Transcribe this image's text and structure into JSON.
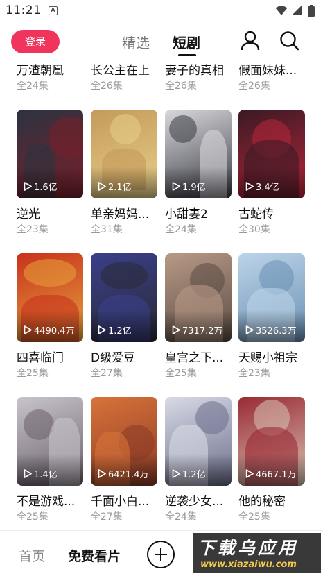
{
  "status_bar": {
    "time": "11:21",
    "notification_icon": "a-notification-icon"
  },
  "header": {
    "login_label": "登录",
    "tabs": [
      {
        "label": "精选",
        "active": false
      },
      {
        "label": "短剧",
        "active": true
      }
    ],
    "accent": "#f0345c"
  },
  "rows": [
    {
      "items": [
        {
          "title": "万渣朝凰",
          "episodes": "全24集"
        },
        {
          "title": "长公主在上",
          "episodes": "全26集"
        },
        {
          "title": "妻子的真相",
          "episodes": "全26集"
        },
        {
          "title": "假面妹妹...",
          "episodes": "全26集"
        }
      ]
    },
    {
      "items": [
        {
          "title": "逆光",
          "episodes": "全23集",
          "views": "1.6亿",
          "colors": [
            "#2b3340",
            "#7a1f2a"
          ]
        },
        {
          "title": "单亲妈妈...",
          "episodes": "全31集",
          "views": "2.1亿",
          "colors": [
            "#c49a5a",
            "#e8d08a"
          ]
        },
        {
          "title": "小甜妻2",
          "episodes": "全24集",
          "views": "1.9亿",
          "colors": [
            "#d8d8dc",
            "#3a3a44"
          ]
        },
        {
          "title": "古蛇传",
          "episodes": "全30集",
          "views": "3.4亿",
          "colors": [
            "#3a1a24",
            "#b8263a"
          ]
        }
      ]
    },
    {
      "items": [
        {
          "title": "四喜临门",
          "episodes": "全25集",
          "views": "4490.4万",
          "colors": [
            "#c8321e",
            "#e6a23a"
          ]
        },
        {
          "title": "D级爱豆",
          "episodes": "全27集",
          "views": "1.2亿",
          "colors": [
            "#3a3f8a",
            "#2a2a34"
          ]
        },
        {
          "title": "皇宫之下...",
          "episodes": "全25集",
          "views": "7317.2万",
          "colors": [
            "#b89a86",
            "#5a4a44"
          ]
        },
        {
          "title": "天赐小祖宗",
          "episodes": "全23集",
          "views": "3526.3万",
          "colors": [
            "#bcd4e8",
            "#6a8fb4"
          ]
        }
      ]
    },
    {
      "items": [
        {
          "title": "不是游戏...",
          "episodes": "全25集",
          "views": "1.4亿",
          "colors": [
            "#c8c4cc",
            "#6a5e6a"
          ]
        },
        {
          "title": "千面小白...",
          "episodes": "全27集",
          "views": "6421.4万",
          "colors": [
            "#d8733a",
            "#8a3a26"
          ]
        },
        {
          "title": "逆袭少女...",
          "episodes": "全24集",
          "views": "1.2亿",
          "colors": [
            "#d8dae6",
            "#6a6e8a"
          ]
        },
        {
          "title": "他的秘密",
          "episodes": "全25集",
          "views": "4667.1万",
          "colors": [
            "#9a2a34",
            "#d8c4b4"
          ]
        }
      ]
    }
  ],
  "bottom_nav": {
    "home_label": "首页",
    "free_label": "免费看片"
  },
  "watermark": {
    "text": "下载乌应用",
    "url": "www.xiazaiwu.com"
  }
}
